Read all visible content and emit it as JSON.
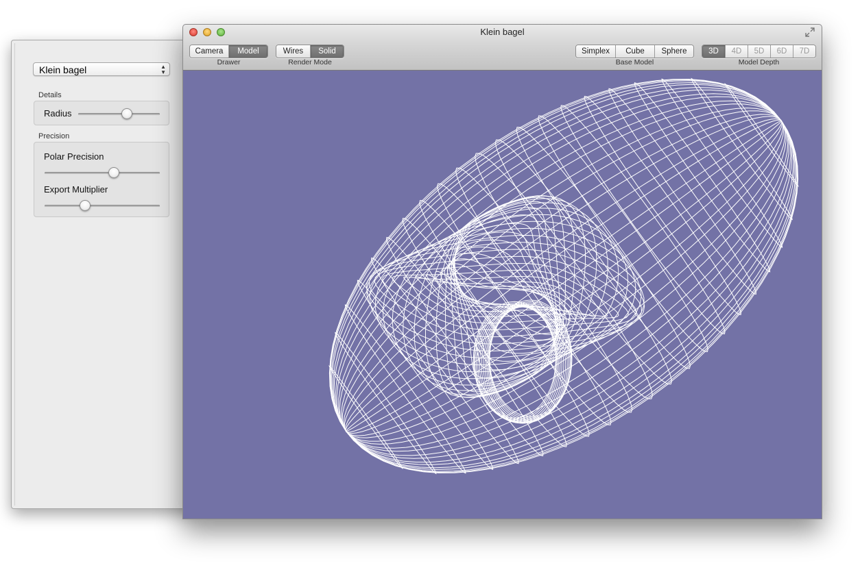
{
  "side_panel": {
    "model_select": {
      "value": "Klein bagel"
    },
    "details": {
      "title": "Details",
      "radius_label": "Radius",
      "radius_level": 0.6
    },
    "precision": {
      "title": "Precision",
      "polar_label": "Polar Precision",
      "polar_level": 0.6,
      "export_label": "Export Multiplier",
      "export_level": 0.35
    }
  },
  "window": {
    "title": "Klein bagel",
    "drawer": {
      "label": "Drawer",
      "options": [
        "Camera",
        "Model"
      ],
      "selected": "Model"
    },
    "render_mode": {
      "label": "Render Mode",
      "options": [
        "Wires",
        "Solid"
      ],
      "selected": "Solid"
    },
    "base_model": {
      "label": "Base Model",
      "options": [
        "Simplex",
        "Cube",
        "Sphere"
      ]
    },
    "model_depth": {
      "label": "Model Depth",
      "options": [
        "3D",
        "4D",
        "5D",
        "6D",
        "7D"
      ],
      "selected": "3D"
    }
  },
  "colors": {
    "viewport_background": "#7372a6",
    "wire": "#ffffff"
  }
}
